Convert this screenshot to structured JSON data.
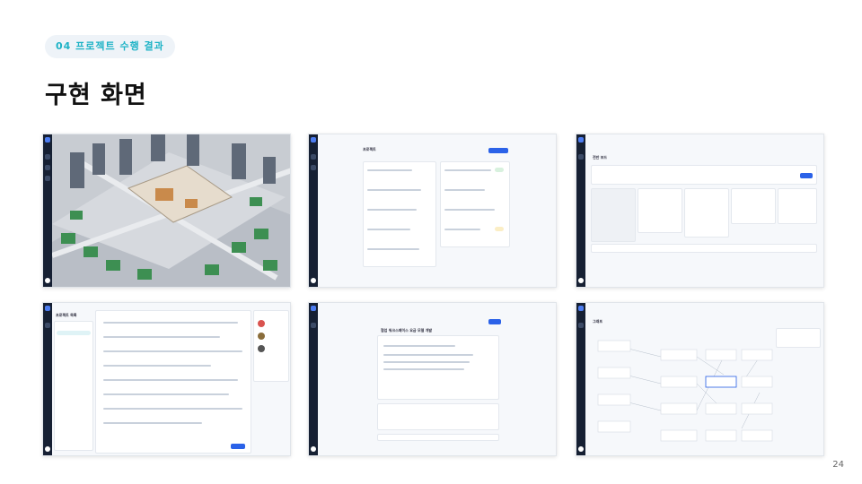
{
  "header": {
    "badge": "04 프로젝트 수행 결과",
    "title": "구현 화면"
  },
  "footer": {
    "page_number": "24"
  },
  "screens": {
    "two": {
      "heading": "프로젝트"
    },
    "three": {
      "heading": "전반 보드"
    },
    "four": {
      "heading": "프로젝트 목록"
    },
    "five": {
      "heading": "협업 워크스페이스 요금 모델 개발"
    },
    "six": {
      "heading": "그래프"
    }
  },
  "colors": {
    "accent": "#1fb3c6",
    "badge_bg": "#eef3f8",
    "sidebar": "#162033",
    "primary": "#2b62e8"
  }
}
